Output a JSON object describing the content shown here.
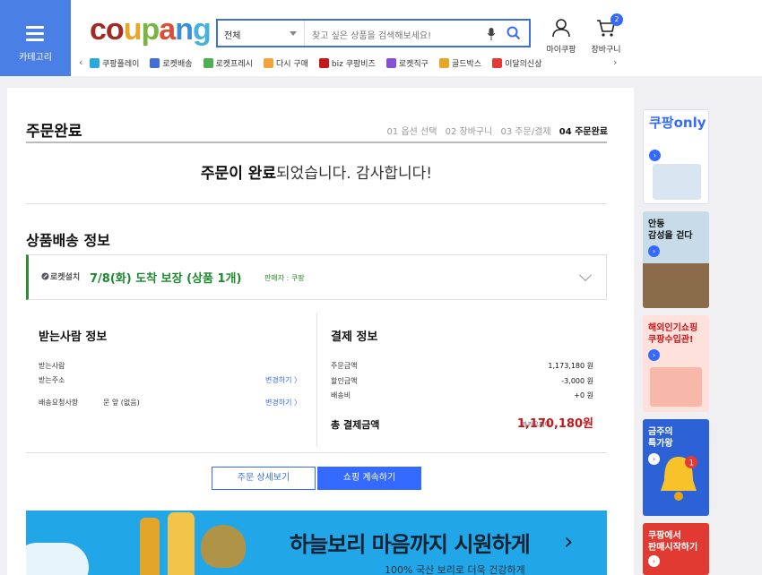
{
  "header": {
    "category_label": "카테고리",
    "logo_letters": [
      "c",
      "o",
      "u",
      "p",
      "a",
      "n",
      "g"
    ],
    "search_category": "전체",
    "search_placeholder": "찾고 싶은 상품을 검색해보세요!",
    "mycoupang_label": "마이쿠팡",
    "cart_label": "장바구니",
    "cart_count": "2",
    "quick_links": [
      {
        "label": "쿠팡플레이",
        "color": "#2aa8e0"
      },
      {
        "label": "로켓배송",
        "color": "#3f6fd8"
      },
      {
        "label": "로켓프레시",
        "color": "#4caf50"
      },
      {
        "label": "다시 구매",
        "color": "#f2a33a"
      },
      {
        "label": "biz 쿠팡비즈",
        "color": "#c8161d"
      },
      {
        "label": "로켓직구",
        "color": "#8a4fd8"
      },
      {
        "label": "골드박스",
        "color": "#e8a628"
      },
      {
        "label": "이달의신상",
        "color": "#e53935"
      }
    ]
  },
  "page": {
    "title": "주문완료",
    "steps": [
      "01 옵션 선택",
      "02 장바구니",
      "03 주문/결제",
      "04 주문완료"
    ],
    "complete_strong": "주문이 완료",
    "complete_rest": "되었습니다. 감사합니다!",
    "delivery_section": "상품배송 정보",
    "delivery": {
      "rocket": "로켓설치",
      "date_text": "7/8(화) 도착 보장 (상품 1개)",
      "seller": "판매자 : 쿠팡"
    },
    "receiver": {
      "heading": "받는사람 정보",
      "name_label": "받는사람",
      "address_label": "받는주소",
      "address_change": "변경하기 〉",
      "request_label": "배송요청사항",
      "request_value": "문 앞 (없음)",
      "request_change": "변경하기 〉"
    },
    "payment": {
      "heading": "결제 정보",
      "rows": [
        {
          "label": "주문금액",
          "value": "1,173,180 원"
        },
        {
          "label": "할인금액",
          "value": "-3,000 원"
        },
        {
          "label": "배송비",
          "value": "+0 원"
        }
      ],
      "total_label": "총 결제금액",
      "total_method": "카카오페이",
      "total_value": "1,170,180원"
    },
    "btn_detail": "주문 상세보기",
    "btn_continue": "쇼핑 계속하기",
    "banner_title": "하늘보리 마음까지 시원하게",
    "banner_sub": "100% 국산 보리로 더욱 건강하게",
    "banner_next": "›"
  },
  "rail": [
    {
      "title": "쿠팡only"
    },
    {
      "title": "안동\n감성을 걷다"
    },
    {
      "title": "해외인기쇼핑\n쿠팡수입관!"
    },
    {
      "title": "금주의\n특가왕"
    },
    {
      "title": "쿠팡에서\n판매시작하기"
    }
  ],
  "colors": {
    "brand_blue": "#346aff",
    "price_red": "#c8161d",
    "rocket_green": "#1c8a2e"
  }
}
